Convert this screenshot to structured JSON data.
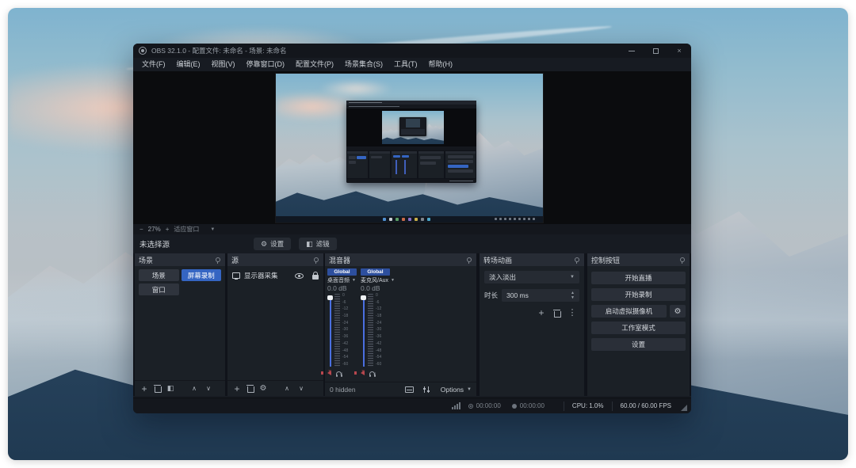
{
  "window": {
    "title": "OBS 32.1.0 - 配置文件: 未命名 - 场景: 未命名",
    "menus": [
      "文件(F)",
      "编辑(E)",
      "视图(V)",
      "停靠窗口(D)",
      "配置文件(P)",
      "场景集合(S)",
      "工具(T)",
      "帮助(H)"
    ]
  },
  "preview": {
    "zoom_out": "−",
    "zoom_level": "27%",
    "zoom_in": "+",
    "zoom_mode": "适应窗口",
    "no_source_text": "未选择源",
    "settings_button": "设置",
    "filters_button": "滤镜"
  },
  "docks": {
    "scenes": {
      "title": "场景",
      "items": [
        {
          "label": "场景"
        },
        {
          "label": "屏幕录制"
        },
        {
          "label": "窗口"
        }
      ]
    },
    "sources": {
      "title": "源",
      "items": [
        {
          "label": "显示器采集"
        }
      ]
    },
    "mixer": {
      "title": "混音器",
      "channels": [
        {
          "badge": "Global",
          "name": "桌面音频",
          "volume": "0.0 dB"
        },
        {
          "badge": "Global",
          "name": "麦克风/Aux",
          "volume": "0.0 dB"
        }
      ],
      "ticks": [
        "0",
        "-6",
        "-12",
        "-18",
        "-24",
        "-30",
        "-36",
        "-42",
        "-48",
        "-54",
        "-60"
      ],
      "hidden_count": "0 hidden",
      "options_label": "Options"
    },
    "transitions": {
      "title": "转场动画",
      "current": "淡入淡出",
      "duration_label": "时长",
      "duration_value": "300 ms"
    },
    "controls": {
      "title": "控制按钮",
      "stream": "开始直播",
      "record": "开始录制",
      "virtualcam": "启动虚拟摄像机",
      "studio_mode": "工作室模式",
      "settings": "设置"
    }
  },
  "statusbar": {
    "stream_time": "00:00:00",
    "record_time": "00:00:00",
    "cpu": "CPU: 1.0%",
    "fps": "60.00 / 60.00 FPS"
  },
  "colors": {
    "accent": "#3565c2",
    "badge_blue": "#2d4f9e",
    "fader_blue": "#4a6fe0",
    "mute_red": "#b8474e"
  }
}
